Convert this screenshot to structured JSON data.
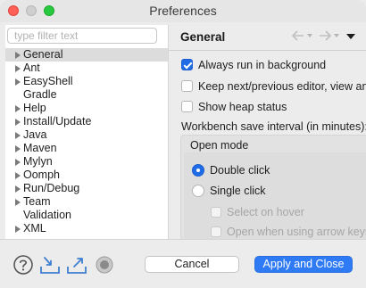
{
  "window": {
    "title": "Preferences"
  },
  "sidebar": {
    "filter_placeholder": "type filter text",
    "items": [
      {
        "label": "General",
        "expandable": true,
        "selected": true
      },
      {
        "label": "Ant",
        "expandable": true
      },
      {
        "label": "EasyShell",
        "expandable": true
      },
      {
        "label": "Gradle",
        "expandable": false
      },
      {
        "label": "Help",
        "expandable": true
      },
      {
        "label": "Install/Update",
        "expandable": true
      },
      {
        "label": "Java",
        "expandable": true
      },
      {
        "label": "Maven",
        "expandable": true
      },
      {
        "label": "Mylyn",
        "expandable": true
      },
      {
        "label": "Oomph",
        "expandable": true
      },
      {
        "label": "Run/Debug",
        "expandable": true
      },
      {
        "label": "Team",
        "expandable": true
      },
      {
        "label": "Validation",
        "expandable": false
      },
      {
        "label": "XML",
        "expandable": true
      }
    ]
  },
  "page": {
    "title": "General",
    "nav_icons": [
      "back-arrow-icon",
      "forward-arrow-icon",
      "view-menu-icon"
    ],
    "options": [
      {
        "label": "Always run in background",
        "checked": true
      },
      {
        "label": "Keep next/previous editor, view and",
        "checked": false
      },
      {
        "label": "Show heap status",
        "checked": false
      }
    ],
    "interval_label": "Workbench save interval (in minutes):",
    "open_mode": {
      "title": "Open mode",
      "radios": [
        {
          "label": "Double click",
          "selected": true
        },
        {
          "label": "Single click",
          "selected": false
        }
      ],
      "sub_options": [
        {
          "label": "Select on hover",
          "enabled": false
        },
        {
          "label": "Open when using arrow keys",
          "enabled": false
        }
      ]
    }
  },
  "footer": {
    "icons": [
      "help-icon",
      "import-icon",
      "export-icon",
      "record-icon"
    ],
    "cancel_label": "Cancel",
    "apply_close_label": "Apply and Close"
  },
  "colors": {
    "accent": "#2f7bf5",
    "checked": "#1f6ce6",
    "selection": "#dcdcdc"
  }
}
